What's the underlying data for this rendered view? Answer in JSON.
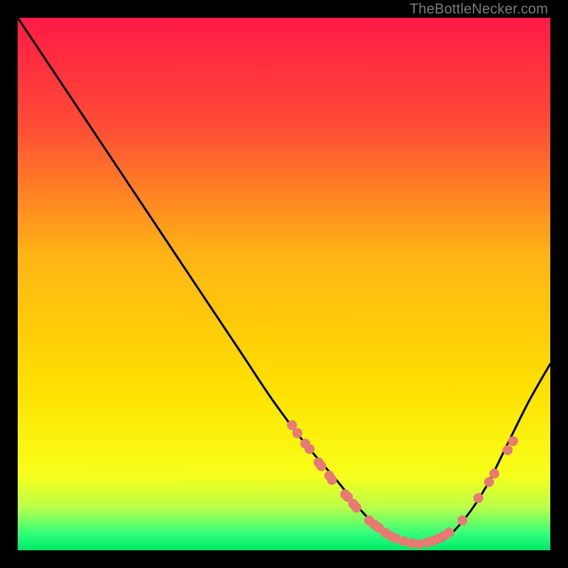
{
  "watermark": "TheBottleNecker.com",
  "chart_data": {
    "type": "line",
    "title": "",
    "xlabel": "",
    "ylabel": "",
    "xlim": [
      0,
      100
    ],
    "ylim": [
      0,
      100
    ],
    "gradient_stops": [
      {
        "offset": 0,
        "color": "#ff1a46"
      },
      {
        "offset": 20,
        "color": "#ff4b36"
      },
      {
        "offset": 45,
        "color": "#ffb514"
      },
      {
        "offset": 70,
        "color": "#ffe100"
      },
      {
        "offset": 86,
        "color": "#f7ff1a"
      },
      {
        "offset": 92,
        "color": "#b9ff4a"
      },
      {
        "offset": 97,
        "color": "#2fff7a"
      },
      {
        "offset": 100,
        "color": "#00e86b"
      }
    ],
    "series": [
      {
        "name": "bottleneck-curve",
        "x": [
          0,
          6,
          12,
          18,
          24,
          30,
          36,
          42,
          48,
          54,
          60,
          64,
          68,
          72,
          76,
          80,
          84,
          88,
          92,
          96,
          100
        ],
        "y": [
          100,
          91,
          82,
          73,
          64,
          55,
          46,
          37,
          28,
          20,
          13,
          8,
          4,
          2,
          1,
          2,
          6,
          12,
          20,
          28,
          35
        ]
      }
    ],
    "markers": {
      "name": "highlight-points",
      "color": "#e77a72",
      "radius": 7,
      "points": [
        {
          "x": 51.5,
          "y": 23.5
        },
        {
          "x": 52.5,
          "y": 22.0
        },
        {
          "x": 54.0,
          "y": 20.0
        },
        {
          "x": 54.8,
          "y": 19.0
        },
        {
          "x": 56.5,
          "y": 16.5
        },
        {
          "x": 57.0,
          "y": 15.8
        },
        {
          "x": 58.5,
          "y": 14.0
        },
        {
          "x": 59.0,
          "y": 13.2
        },
        {
          "x": 61.5,
          "y": 10.5
        },
        {
          "x": 62.0,
          "y": 10.0
        },
        {
          "x": 63.0,
          "y": 8.7
        },
        {
          "x": 63.6,
          "y": 8.0
        },
        {
          "x": 66.0,
          "y": 5.6
        },
        {
          "x": 67.0,
          "y": 4.8
        },
        {
          "x": 67.8,
          "y": 4.2
        },
        {
          "x": 69.0,
          "y": 3.3
        },
        {
          "x": 70.0,
          "y": 2.7
        },
        {
          "x": 71.0,
          "y": 2.2
        },
        {
          "x": 72.5,
          "y": 1.7
        },
        {
          "x": 74.0,
          "y": 1.3
        },
        {
          "x": 75.5,
          "y": 1.2
        },
        {
          "x": 77.0,
          "y": 1.5
        },
        {
          "x": 78.0,
          "y": 1.8
        },
        {
          "x": 79.0,
          "y": 2.2
        },
        {
          "x": 80.0,
          "y": 2.7
        },
        {
          "x": 81.0,
          "y": 3.3
        },
        {
          "x": 83.5,
          "y": 5.6
        },
        {
          "x": 86.5,
          "y": 9.8
        },
        {
          "x": 88.5,
          "y": 12.8
        },
        {
          "x": 89.5,
          "y": 14.4
        },
        {
          "x": 92.0,
          "y": 18.8
        },
        {
          "x": 93.0,
          "y": 20.5
        }
      ]
    }
  }
}
